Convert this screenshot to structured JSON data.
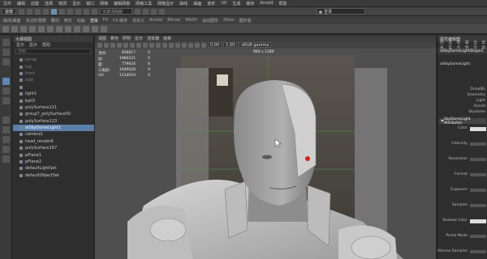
{
  "menubar": [
    "文件",
    "编辑",
    "创建",
    "选择",
    "修改",
    "显示",
    "窗口",
    "网格",
    "编辑网格",
    "网格工具",
    "网格显示",
    "曲线",
    "曲面",
    "变形",
    "UV",
    "生成",
    "缓存",
    "Arnold",
    "帮助"
  ],
  "status_line": {
    "mode": "建模",
    "search_placeholder": "无激活曲面",
    "user": "登录"
  },
  "shelf_tabs": [
    "曲线/曲面",
    "多边形建模",
    "雕刻",
    "绑定",
    "动画",
    "渲染",
    "FX",
    "FX 缓存",
    "自定义",
    "Arnold",
    "Bifrost",
    "MASH",
    "运动图形",
    "XGen",
    "图形窗"
  ],
  "shelf_active_tab": "渲染",
  "outliner": {
    "title": "大纲视图",
    "menu": [
      "显示",
      "显示",
      "帮助"
    ],
    "search_placeholder": "搜索...",
    "items": [
      {
        "label": "persp",
        "dim": true,
        "selected": false
      },
      {
        "label": "top",
        "dim": true,
        "selected": false
      },
      {
        "label": "front",
        "dim": true,
        "selected": false
      },
      {
        "label": "side",
        "dim": true,
        "selected": false
      },
      {
        "label": "",
        "dim": true,
        "selected": false
      },
      {
        "label": "light1",
        "dim": false,
        "selected": false
      },
      {
        "label": "ball3",
        "dim": false,
        "selected": false
      },
      {
        "label": "polySurface121",
        "dim": false,
        "selected": false
      },
      {
        "label": "group7_polySurface50",
        "dim": false,
        "selected": false
      },
      {
        "label": "polySurface123",
        "dim": false,
        "selected": false
      },
      {
        "label": "aiSkyDomeLight1",
        "dim": false,
        "selected": true
      },
      {
        "label": "camera1",
        "dim": false,
        "selected": false
      },
      {
        "label": "head_render6",
        "dim": false,
        "selected": false
      },
      {
        "label": "polySurface167",
        "dim": false,
        "selected": false
      },
      {
        "label": "pPlane1",
        "dim": false,
        "selected": false
      },
      {
        "label": "pPlane2",
        "dim": false,
        "selected": false
      },
      {
        "label": "defaultLightSet",
        "dim": false,
        "selected": false
      },
      {
        "label": "defaultObjectSet",
        "dim": false,
        "selected": false
      }
    ]
  },
  "viewport": {
    "menu": [
      "视图",
      "着色",
      "照明",
      "显示",
      "渲染器",
      "面板"
    ],
    "exposure": "0.00",
    "gamma": "1.00",
    "color_space": "sRGB gamma",
    "resolution_label": "960 x 1280",
    "hud": [
      {
        "k": "顶点:",
        "v": "958817",
        "v2": "0"
      },
      {
        "k": "边:",
        "v": "1966221",
        "v2": "0"
      },
      {
        "k": "面:",
        "v": "779624",
        "v2": "0"
      },
      {
        "k": "三角形:",
        "v": "1649628",
        "v2": "0"
      },
      {
        "k": "UV:",
        "v": "1134019",
        "v2": "0"
      }
    ]
  },
  "attribute_editor": {
    "title": "属性编辑器",
    "tabs": [
      "列表",
      "选定",
      "焦点",
      "属性",
      "显示",
      "帮助"
    ],
    "node_name": "aiSkyDomeLight1",
    "node_tab": "aiSkyDomeLightShape1",
    "type_label": "aiSkyDomeLight:",
    "items_top": [
      "DrawIBL",
      "Geometry",
      "Light",
      "Arnold",
      "Skydome"
    ],
    "section": "SkyDomeLight Attributes",
    "attrs": [
      "Color",
      "Intensity",
      "Resolution",
      "Format",
      "Exposure",
      "Samples",
      "Shadow Color",
      "Portal Mode",
      "Volume Samples"
    ]
  },
  "colors": {
    "selection": "#5a7fa8",
    "viewport_bg": "#4d4d4d",
    "panel_bg": "#2e2e2e"
  }
}
